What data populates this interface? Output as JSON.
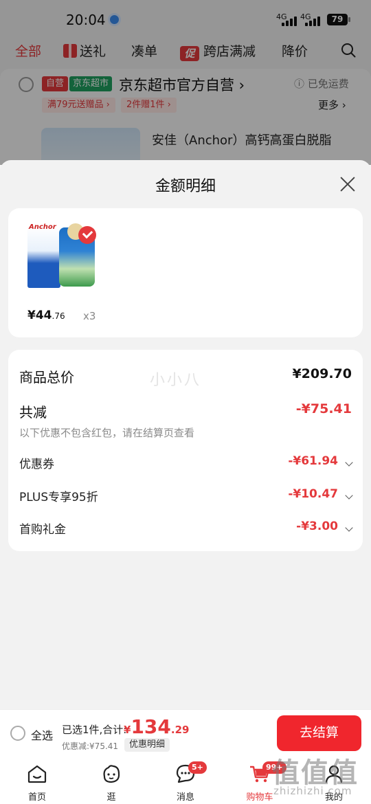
{
  "status": {
    "time": "20:04",
    "net1": "4G",
    "net2": "4G",
    "battery": "79"
  },
  "tabs": [
    {
      "label": "全部"
    },
    {
      "label": "送礼"
    },
    {
      "label": "凑单"
    },
    {
      "label": "跨店满减",
      "icon_text": "促"
    },
    {
      "label": "降价"
    }
  ],
  "shop": {
    "tag_self": "自营",
    "tag_market": "京东超市",
    "name": "京东超市官方自营 ›",
    "free_shipping": "ⓘ 已免运费",
    "promos": [
      "满79元送赠品 ›",
      "2件赠1件 ›"
    ],
    "more": "更多 ›",
    "product_title": "安佳（Anchor）高钙高蛋白脱脂"
  },
  "sheet": {
    "title": "金额明细",
    "product": {
      "price_main": "¥44",
      "price_decimal": ".76",
      "quantity": "x3",
      "logo": "Anchor"
    },
    "watermark": "小小八",
    "total_label": "商品总价",
    "total_value": "¥209.70",
    "reduce_label": "共减",
    "reduce_value": "-¥75.41",
    "reduce_note": "以下优惠不包含红包，请在结算页查看",
    "items": [
      {
        "label": "优惠券",
        "value": "-¥61.94"
      },
      {
        "label": "PLUS专享95折",
        "value": "-¥10.47"
      },
      {
        "label": "首购礼金",
        "value": "-¥3.00"
      }
    ]
  },
  "checkout": {
    "select_all": "全选",
    "selected_info": "已选1件,合计:",
    "currency": "¥",
    "total_int": "134",
    "total_dec": ".29",
    "discount_info": "优惠减:¥75.41",
    "detail_chip": "优惠明细",
    "button": "去结算"
  },
  "nav": [
    {
      "label": "首页"
    },
    {
      "label": "逛"
    },
    {
      "label": "消息",
      "badge": "5+"
    },
    {
      "label": "购物车",
      "badge": "99+"
    },
    {
      "label": "我的"
    }
  ],
  "site_watermark": "值值值",
  "site_watermark_sub": "zhizhizhi.com",
  "colors": {
    "accent": "#e4393c",
    "checkout_button": "#f0262d"
  }
}
